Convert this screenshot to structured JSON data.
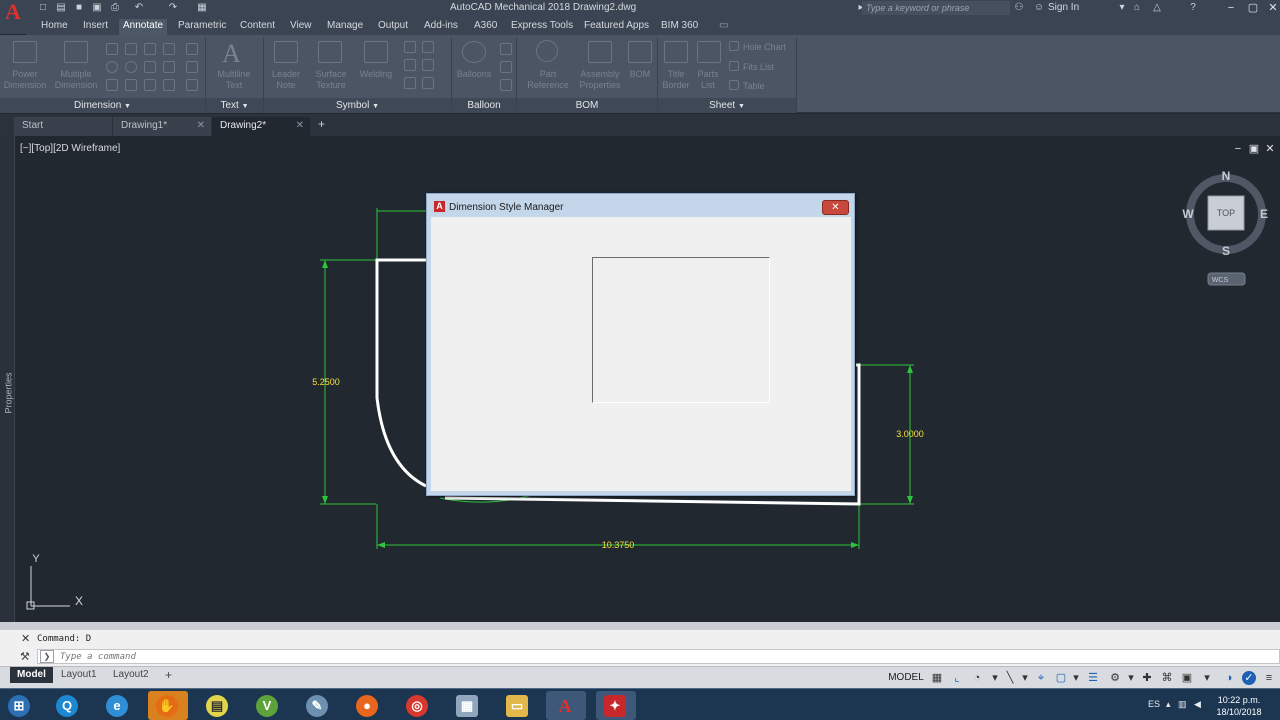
{
  "titlebar": {
    "app_letter": "A",
    "title": "AutoCAD Mechanical 2018    Drawing2.dwg",
    "search_placeholder": "Type a keyword or phrase",
    "sign_in": "Sign In"
  },
  "ribbon_tabs": [
    "Home",
    "Insert",
    "Annotate",
    "Parametric",
    "Content",
    "View",
    "Manage",
    "Output",
    "Add-ins",
    "A360",
    "Express Tools",
    "Featured Apps",
    "BIM 360"
  ],
  "ribbon_active_tab": "Annotate",
  "ribbon_items": {
    "power_dimension": "Power\nDimension",
    "multiple_dimension": "Multiple\nDimension",
    "multiline_text": "Multiline\nText",
    "leader_note": "Leader\nNote",
    "surface_texture": "Surface\nTexture",
    "welding": "Welding",
    "balloons": "Balloons",
    "part_reference": "Part\nReference",
    "assembly_properties": "Assembly\nProperties",
    "bom": "BOM",
    "title_border": "Title\nBorder",
    "parts_list": "Parts\nList",
    "hole_chart": "Hole Chart",
    "fits_list": "Fits List",
    "table": "Table"
  },
  "ribbon_panels": [
    "Dimension",
    "Text",
    "Symbol",
    "Balloon",
    "BOM",
    "Sheet"
  ],
  "file_tabs": [
    "Start",
    "Drawing1*",
    "Drawing2*"
  ],
  "active_file_tab": "Drawing2*",
  "viewport_label": "[−][Top][2D Wireframe]",
  "properties_label": "Properties",
  "viewcube": {
    "north": "N",
    "south": "S",
    "east": "E",
    "west": "W",
    "top": "TOP",
    "wcs": "WCS"
  },
  "dimensions": {
    "d_left": "5.2500",
    "d_right": "3.0000",
    "d_bottom": "10.3750"
  },
  "ucs": {
    "y": "Y",
    "x": "X"
  },
  "dialog": {
    "title": "Dimension Style Manager",
    "close_label": "✕"
  },
  "command": {
    "history": "Command: D",
    "placeholder": "Type a command"
  },
  "layout_tabs": [
    "Model",
    "Layout1",
    "Layout2"
  ],
  "status": {
    "model": "MODEL",
    "language": "ES"
  },
  "clock": {
    "time": "10:22 p.m.",
    "date": "18/10/2018"
  },
  "colors": {
    "dimension_green": "#2ec43c",
    "dimension_text": "#f5e03a",
    "geometry_white": "#ffffff",
    "canvas": "#212830"
  }
}
